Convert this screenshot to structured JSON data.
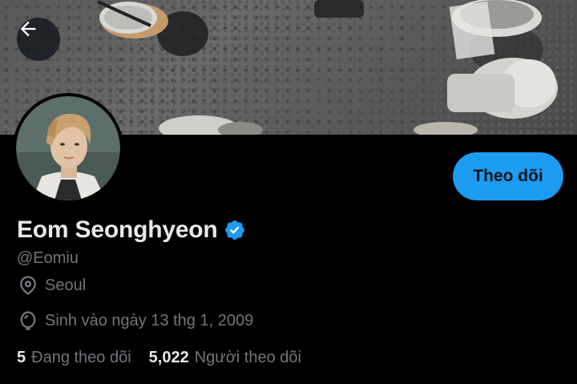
{
  "header": {
    "back_icon": "arrow-left-icon"
  },
  "profile": {
    "display_name": "Eom Seonghyeon",
    "verified_icon": "verified-badge-icon",
    "handle": "@Eomiu",
    "location": "Seoul",
    "location_icon": "map-pin-icon",
    "birthdate": "Sinh vào ngày 13 thg 1, 2009",
    "birthdate_icon": "balloon-icon",
    "follow_button_label": "Theo dõi"
  },
  "stats": {
    "following_count": "5",
    "following_label": "Đang theo dõi",
    "followers_count": "5,022",
    "followers_label": "Người theo dõi"
  },
  "colors": {
    "accent": "#1d9bf0",
    "background": "#000000",
    "secondary_text": "#71767b",
    "primary_text": "#e7e9ea"
  }
}
